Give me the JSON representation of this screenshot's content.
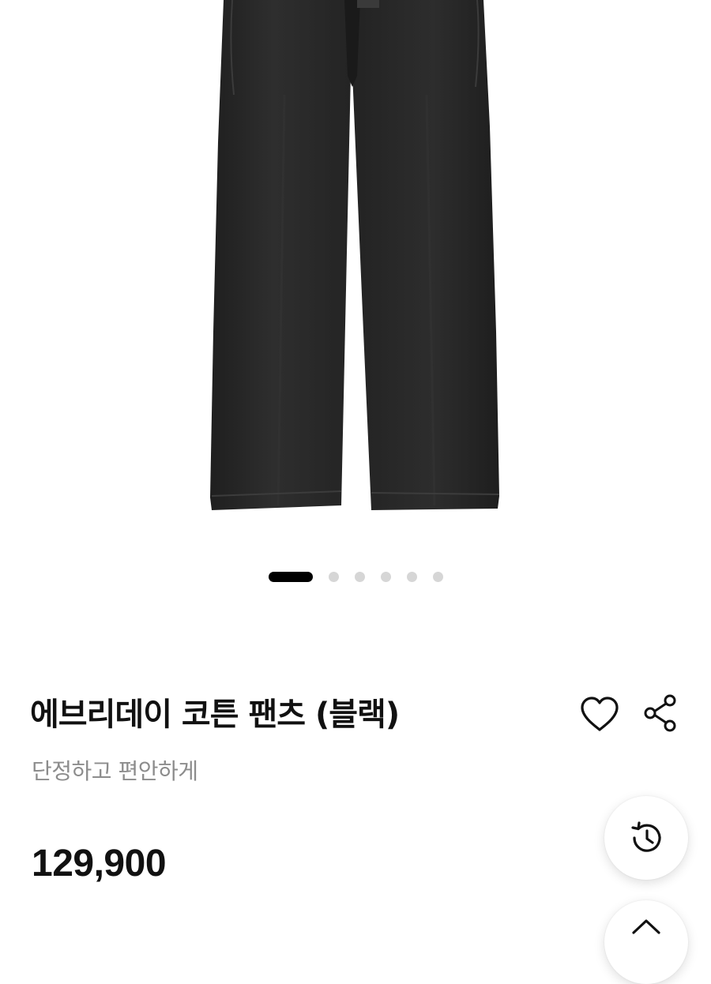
{
  "product": {
    "name": "에브리데이 코튼 팬츠 (블랙)",
    "tagline": "단정하고 편안하게",
    "price": "129,900",
    "image": "black-cotton-pants-photo"
  },
  "gallery": {
    "total_images": 6,
    "current_index": 1
  },
  "actions": {
    "like_icon": "heart-outline-icon",
    "share_icon": "share-icon"
  },
  "floating": {
    "history_icon": "history-icon",
    "top_icon": "chevron-up-icon"
  },
  "colors": {
    "pants": "#2a2a2a",
    "active_dot": "#000000",
    "inactive_dot": "#d6d6d6",
    "subtitle_text": "#8c8c8c"
  }
}
